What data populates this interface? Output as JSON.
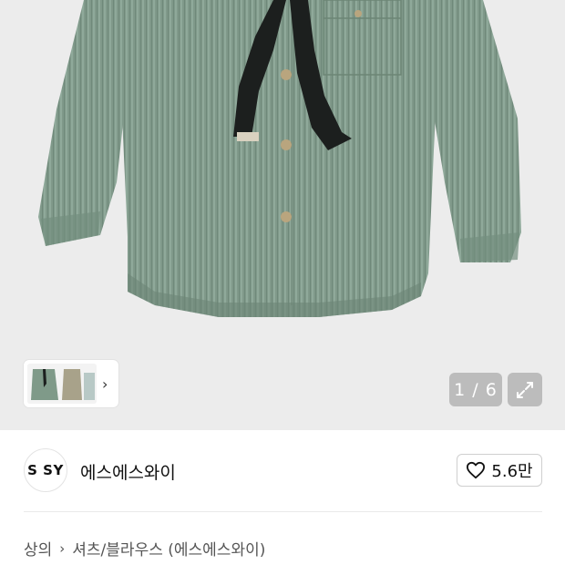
{
  "gallery": {
    "counter": "1 / 6",
    "thumbnail_alt": "product-thumbnails",
    "expand_icon": "expand-icon",
    "next_icon": "chevron-right-icon"
  },
  "brand": {
    "logo_text": "S SY",
    "name": "에스에스와이"
  },
  "like": {
    "icon": "heart-icon",
    "count": "5.6만"
  },
  "breadcrumb": {
    "category": "상의",
    "subcategory": "셔츠/블라우스 (에스에스와이)",
    "separator_icon": "chevron-right-icon"
  },
  "colors": {
    "shirt": "#7f9a89",
    "tie": "#1c1f1e",
    "background": "#ececec"
  }
}
